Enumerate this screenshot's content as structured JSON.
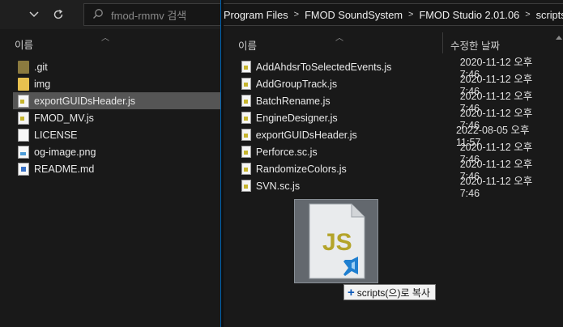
{
  "left_pane": {
    "search_placeholder": "fmod-rmmv 검색",
    "column_name": "이름",
    "items": [
      {
        "name": ".git",
        "icon": "folder-icon",
        "selected": false
      },
      {
        "name": "img",
        "icon": "folder-icon",
        "selected": false
      },
      {
        "name": "exportGUIDsHeader.js",
        "icon": "js-file-icon",
        "selected": true
      },
      {
        "name": "FMOD_MV.js",
        "icon": "js-file-icon",
        "selected": false
      },
      {
        "name": "LICENSE",
        "icon": "file-icon",
        "selected": false
      },
      {
        "name": "og-image.png",
        "icon": "image-file-icon",
        "selected": false
      },
      {
        "name": "README.md",
        "icon": "markdown-file-icon",
        "selected": false
      }
    ]
  },
  "right_pane": {
    "breadcrumb": [
      "Program Files",
      "FMOD SoundSystem",
      "FMOD Studio 2.01.06",
      "scripts"
    ],
    "column_name": "이름",
    "column_date": "수정한 날짜",
    "files": [
      {
        "name": "AddAhdsrToSelectedEvents.js",
        "date": "2020-11-12 오후 7:46"
      },
      {
        "name": "AddGroupTrack.js",
        "date": "2020-11-12 오후 7:46"
      },
      {
        "name": "BatchRename.js",
        "date": "2020-11-12 오후 7:46"
      },
      {
        "name": "EngineDesigner.js",
        "date": "2020-11-12 오후 7:46"
      },
      {
        "name": "exportGUIDsHeader.js",
        "date": "2022-08-05 오후 11:57"
      },
      {
        "name": "Perforce.sc.js",
        "date": "2020-11-12 오후 7:46"
      },
      {
        "name": "RandomizeColors.js",
        "date": "2020-11-12 오후 7:46"
      },
      {
        "name": "SVN.sc.js",
        "date": "2020-11-12 오후 7:46"
      }
    ]
  },
  "drag": {
    "icon_text": "JS",
    "tooltip": "scripts(으)로 복사"
  }
}
